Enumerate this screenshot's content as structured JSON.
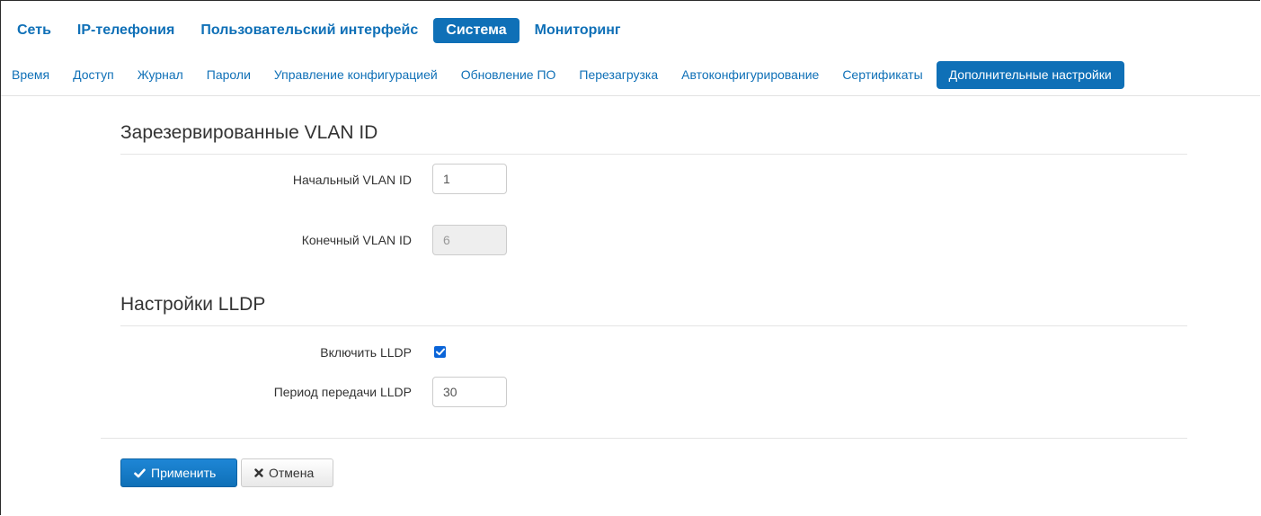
{
  "nav": {
    "main_tabs": [
      {
        "label": "Сеть"
      },
      {
        "label": "IP-телефония"
      },
      {
        "label": "Пользовательский интерфейс"
      },
      {
        "label": "Система",
        "active": true
      },
      {
        "label": "Мониторинг"
      }
    ],
    "sub_tabs": [
      {
        "label": "Время"
      },
      {
        "label": "Доступ"
      },
      {
        "label": "Журнал"
      },
      {
        "label": "Пароли"
      },
      {
        "label": "Управление конфигурацией"
      },
      {
        "label": "Обновление ПО"
      },
      {
        "label": "Перезагрузка"
      },
      {
        "label": "Автоконфигурирование"
      },
      {
        "label": "Сертификаты"
      },
      {
        "label": "Дополнительные настройки",
        "active": true
      }
    ]
  },
  "vlan": {
    "title": "Зарезервированные VLAN ID",
    "start_label": "Начальный VLAN ID",
    "start_value": "1",
    "end_label": "Конечный VLAN ID",
    "end_value": "6"
  },
  "lldp": {
    "title": "Настройки LLDP",
    "enable_label": "Включить LLDP",
    "enable_checked": true,
    "period_label": "Период передачи LLDP",
    "period_value": "30"
  },
  "actions": {
    "apply_label": "Применить",
    "cancel_label": "Отмена"
  },
  "colors": {
    "accent": "#0f70b7",
    "checkbox": "#0a64d8"
  },
  "icons": {
    "apply": "check-icon",
    "cancel": "x-icon"
  }
}
